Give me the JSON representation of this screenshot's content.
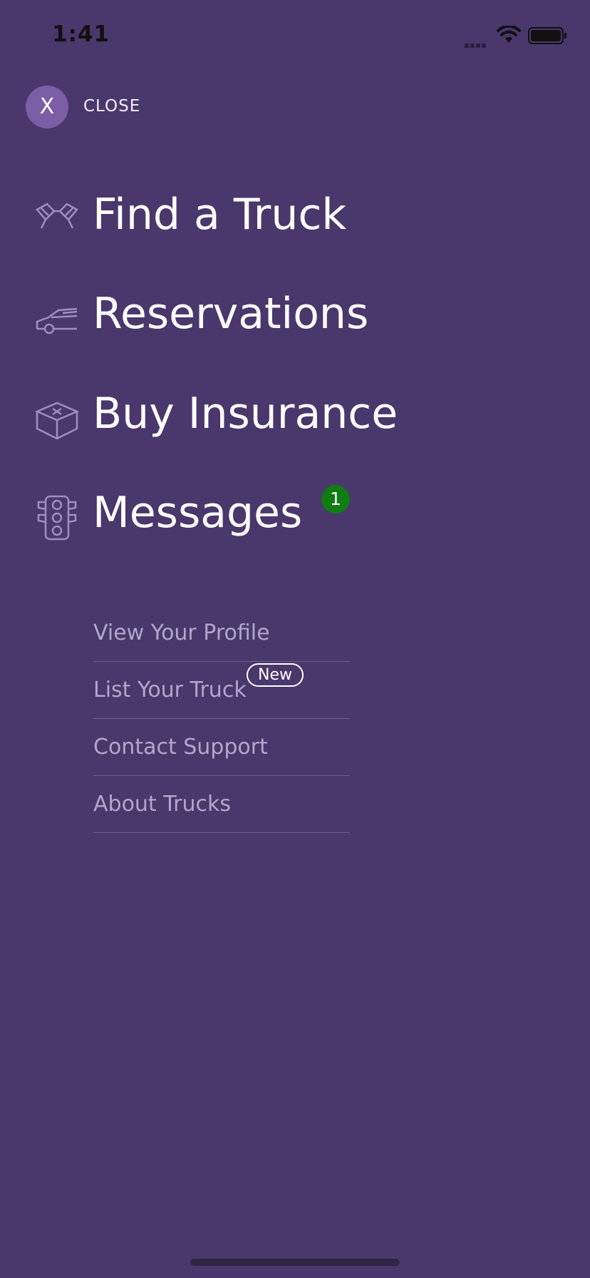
{
  "status_bar": {
    "time": "1:41"
  },
  "close": {
    "button_text": "X",
    "label": "CLOSE"
  },
  "main_menu": [
    {
      "label": "Find a Truck",
      "icon": "checkered-flags-icon"
    },
    {
      "label": "Reservations",
      "icon": "car-icon"
    },
    {
      "label": "Buy Insurance",
      "icon": "first-aid-box-icon"
    },
    {
      "label": "Messages",
      "icon": "traffic-light-icon",
      "badge": "1"
    }
  ],
  "secondary_menu": [
    {
      "label": "View Your Profile"
    },
    {
      "label": "List Your Truck",
      "badge": "New"
    },
    {
      "label": "Contact Support"
    },
    {
      "label": "About Trucks"
    }
  ],
  "colors": {
    "background": "#4a376b",
    "close_button": "#7b5ea6",
    "message_badge": "#0f7d12",
    "secondary_text": "#b3a6cc"
  }
}
